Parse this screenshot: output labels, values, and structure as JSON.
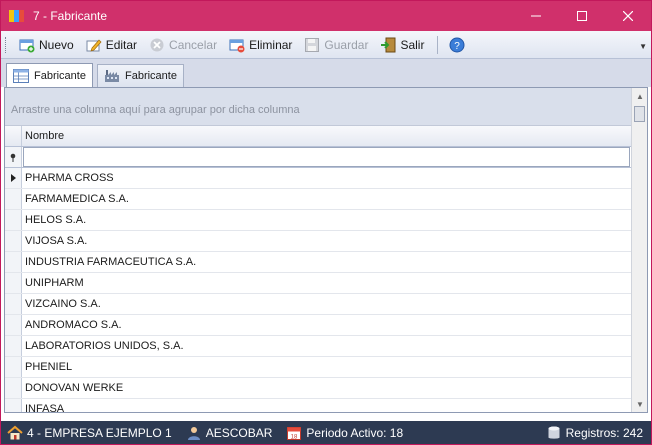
{
  "window": {
    "title": "7 - Fabricante"
  },
  "toolbar": {
    "nuevo": "Nuevo",
    "editar": "Editar",
    "cancelar": "Cancelar",
    "eliminar": "Eliminar",
    "guardar": "Guardar",
    "salir": "Salir"
  },
  "tabs": [
    {
      "label": "Fabricante",
      "active": true,
      "icon": "table-icon"
    },
    {
      "label": "Fabricante",
      "active": false,
      "icon": "factory-icon"
    }
  ],
  "grid": {
    "group_hint": "Arrastre una columna aquí para agrupar por dicha columna",
    "column_header": "Nombre",
    "rows": [
      "PHARMA CROSS",
      "FARMAMEDICA S.A.",
      "HELOS S.A.",
      "VIJOSA S.A.",
      "INDUSTRIA FARMACEUTICA S.A.",
      "UNIPHARM",
      "VIZCAINO S.A.",
      "ANDROMACO S.A.",
      "LABORATORIOS UNIDOS, S.A.",
      "PHENIEL",
      "DONOVAN WERKE",
      "INFASA"
    ]
  },
  "statusbar": {
    "empresa": "4 - EMPRESA EJEMPLO 1",
    "usuario": "AESCOBAR",
    "periodo": "Periodo Activo: 18",
    "registros": "Registros: 242"
  },
  "colors": {
    "titlebar": "#d0306b",
    "statusbar": "#2d3a52"
  }
}
